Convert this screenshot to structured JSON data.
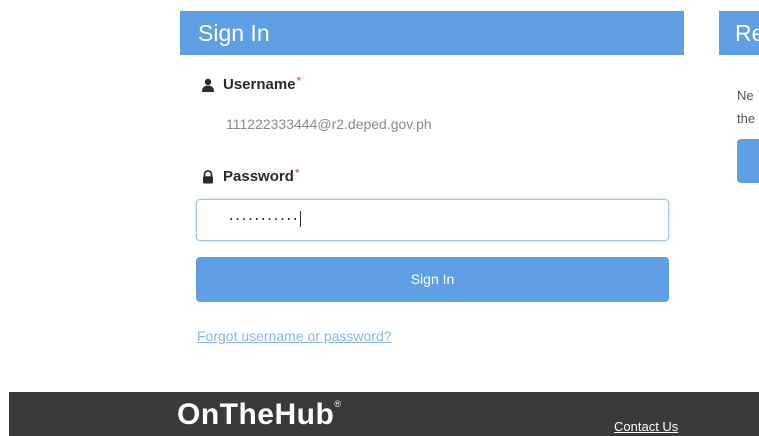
{
  "signin": {
    "header": "Sign In",
    "username_label": "Username",
    "username_required": "*",
    "username_value": "111222333444@r2.deped.gov.ph",
    "password_label": "Password",
    "password_required": "*",
    "password_masked": "···········",
    "signin_button": "Sign In",
    "forgot_link": "Forgot username or password?"
  },
  "register": {
    "header": "Re",
    "text_line1": "Ne",
    "text_line2": "the"
  },
  "footer": {
    "logo": "OnTheHub",
    "logo_mark": "®",
    "contact_link": "Contact Us"
  },
  "icons": {
    "username": "user-icon",
    "password": "lock-icon"
  },
  "colors": {
    "accent": "#5f9fe3",
    "link": "#8ab4e6",
    "required": "#e0443a",
    "footer_bg": "#3a3a3a"
  }
}
